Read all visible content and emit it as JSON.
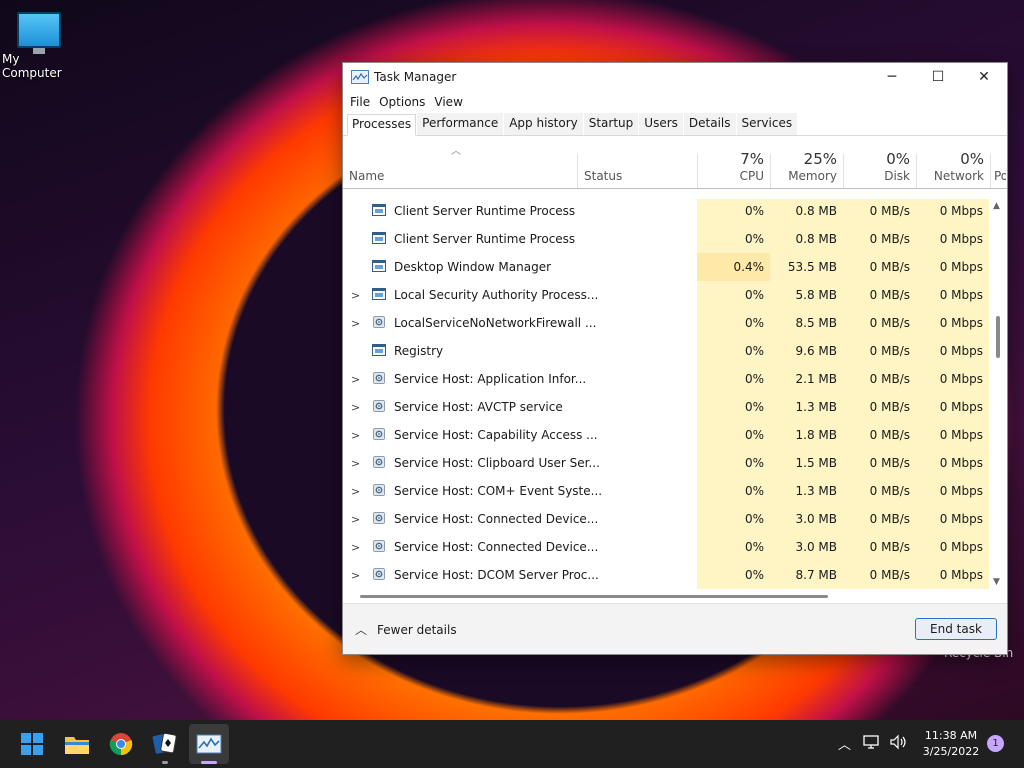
{
  "desktop": {
    "my_computer": "My Computer",
    "recycle_bin": "Recycle Bin"
  },
  "window": {
    "title": "Task Manager",
    "controls": {
      "minimize": "─",
      "maximize": "☐",
      "close": "✕"
    },
    "menu": [
      "File",
      "Options",
      "View"
    ],
    "tabs": [
      "Processes",
      "Performance",
      "App history",
      "Startup",
      "Users",
      "Details",
      "Services"
    ],
    "active_tab": "Processes"
  },
  "columns": {
    "name": "Name",
    "status": "Status",
    "cpu": {
      "percent": "7%",
      "label": "CPU"
    },
    "memory": {
      "percent": "25%",
      "label": "Memory"
    },
    "disk": {
      "percent": "0%",
      "label": "Disk"
    },
    "network": {
      "percent": "0%",
      "label": "Network"
    },
    "power": "Po"
  },
  "processes": [
    {
      "name": "Client Server Runtime Process",
      "expandable": false,
      "icon": "window-icon",
      "cpu": "0%",
      "memory": "0.8 MB",
      "disk": "0 MB/s",
      "network": "0 Mbps"
    },
    {
      "name": "Client Server Runtime Process",
      "expandable": false,
      "icon": "window-icon",
      "cpu": "0%",
      "memory": "0.8 MB",
      "disk": "0 MB/s",
      "network": "0 Mbps"
    },
    {
      "name": "Desktop Window Manager",
      "expandable": false,
      "icon": "window-icon",
      "cpu": "0.4%",
      "memory": "53.5 MB",
      "disk": "0 MB/s",
      "network": "0 Mbps"
    },
    {
      "name": "Local Security Authority Process...",
      "expandable": true,
      "icon": "window-icon",
      "cpu": "0%",
      "memory": "5.8 MB",
      "disk": "0 MB/s",
      "network": "0 Mbps"
    },
    {
      "name": "LocalServiceNoNetworkFirewall ...",
      "expandable": true,
      "icon": "gear-icon",
      "cpu": "0%",
      "memory": "8.5 MB",
      "disk": "0 MB/s",
      "network": "0 Mbps"
    },
    {
      "name": "Registry",
      "expandable": false,
      "icon": "window-icon",
      "cpu": "0%",
      "memory": "9.6 MB",
      "disk": "0 MB/s",
      "network": "0 Mbps"
    },
    {
      "name": "Service Host: Application Infor...",
      "expandable": true,
      "icon": "gear-icon",
      "cpu": "0%",
      "memory": "2.1 MB",
      "disk": "0 MB/s",
      "network": "0 Mbps"
    },
    {
      "name": "Service Host: AVCTP service",
      "expandable": true,
      "icon": "gear-icon",
      "cpu": "0%",
      "memory": "1.3 MB",
      "disk": "0 MB/s",
      "network": "0 Mbps"
    },
    {
      "name": "Service Host: Capability Access ...",
      "expandable": true,
      "icon": "gear-icon",
      "cpu": "0%",
      "memory": "1.8 MB",
      "disk": "0 MB/s",
      "network": "0 Mbps"
    },
    {
      "name": "Service Host: Clipboard User Ser...",
      "expandable": true,
      "icon": "gear-icon",
      "cpu": "0%",
      "memory": "1.5 MB",
      "disk": "0 MB/s",
      "network": "0 Mbps"
    },
    {
      "name": "Service Host: COM+ Event Syste...",
      "expandable": true,
      "icon": "gear-icon",
      "cpu": "0%",
      "memory": "1.3 MB",
      "disk": "0 MB/s",
      "network": "0 Mbps"
    },
    {
      "name": "Service Host: Connected Device...",
      "expandable": true,
      "icon": "gear-icon",
      "cpu": "0%",
      "memory": "3.0 MB",
      "disk": "0 MB/s",
      "network": "0 Mbps"
    },
    {
      "name": "Service Host: Connected Device...",
      "expandable": true,
      "icon": "gear-icon",
      "cpu": "0%",
      "memory": "3.0 MB",
      "disk": "0 MB/s",
      "network": "0 Mbps"
    },
    {
      "name": "Service Host: DCOM Server Proc...",
      "expandable": true,
      "icon": "gear-icon",
      "cpu": "0%",
      "memory": "8.7 MB",
      "disk": "0 MB/s",
      "network": "0 Mbps"
    }
  ],
  "footer": {
    "fewer_details": "Fewer details",
    "end_task": "End task"
  },
  "taskbar": {
    "apps": [
      "start-icon",
      "file-explorer-icon",
      "chrome-icon",
      "solitaire-icon",
      "task-manager-icon"
    ],
    "time": "11:38 AM",
    "date": "3/25/2022",
    "notification_count": "1"
  }
}
